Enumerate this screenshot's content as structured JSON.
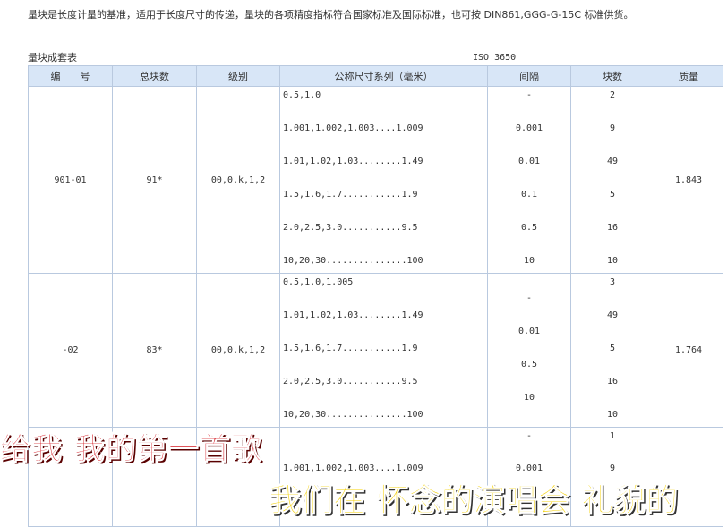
{
  "intro_text": "量块是长度计量的基准，适用于长度尺寸的传递，量块的各项精度指标符合国家标准及国际标准，也可按 DIN861,GGG-G-15C 标准供货。",
  "table_title": "量块成套表",
  "standard_label": "ISO 3650",
  "columns": [
    "编　　号",
    "总块数",
    "级别",
    "公称尺寸系列（毫米）",
    "间隔",
    "块数",
    "质量"
  ],
  "rows": [
    {
      "code": "901-01",
      "total": "91*",
      "grade": "00,0,k,1,2",
      "mass": "1.843",
      "sizes": [
        "0.5,1.0",
        "1.001,1.002,1.003....1.009",
        "1.01,1.02,1.03........1.49",
        "1.5,1.6,1.7...........1.9",
        "2.0,2.5,3.0...........9.5",
        "10,20,30...............100"
      ],
      "steps": [
        "-",
        "0.001",
        "0.01",
        "0.1",
        "0.5",
        "10"
      ],
      "counts": [
        "2",
        "9",
        "49",
        "5",
        "16",
        "10"
      ]
    },
    {
      "code": "-02",
      "total": "83*",
      "grade": "00,0,k,1,2",
      "mass": "1.764",
      "sizes": [
        "0.5,1.0,1.005",
        "1.01,1.02,1.03........1.49",
        "1.5,1.6,1.7...........1.9",
        "2.0,2.5,3.0...........9.5",
        "10,20,30...............100"
      ],
      "steps": [
        "-",
        "0.01",
        "0.5",
        "10"
      ],
      "counts": [
        "3",
        "49",
        "5",
        "16",
        "10"
      ]
    },
    {
      "sizes": [
        "1.001,1.002,1.003....1.009"
      ],
      "steps": [
        "-",
        "0.001"
      ],
      "counts": [
        "1",
        "9"
      ]
    }
  ],
  "overlay_lines": [
    "给我  我的第一首歌",
    "我们在  怀念的演唱会 礼貌的"
  ]
}
